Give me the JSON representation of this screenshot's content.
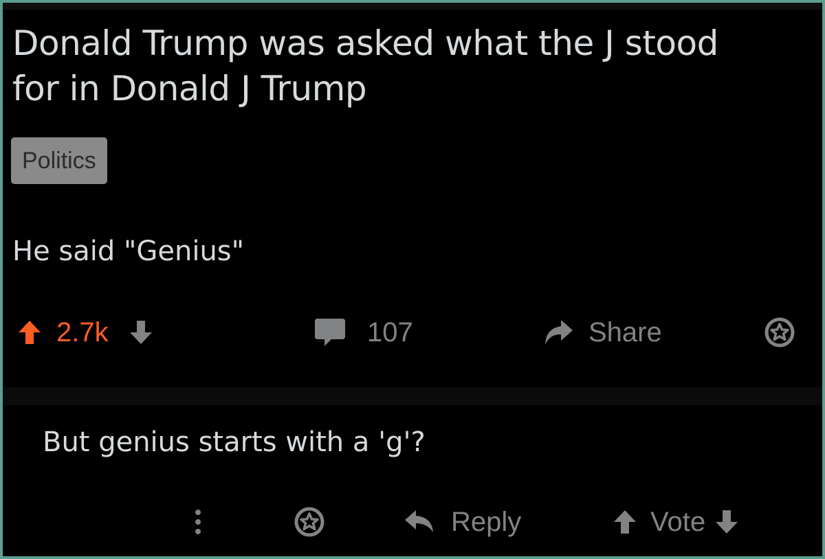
{
  "post": {
    "title": "Donald Trump was asked what the J stood for in Donald J Trump",
    "flair": "Politics",
    "body": "He said \"Genius\"",
    "score": "2.7k",
    "comment_count": "107",
    "share_label": "Share"
  },
  "comment": {
    "text": "But genius starts with a 'g'?",
    "reply_label": "Reply",
    "vote_label": "Vote"
  },
  "colors": {
    "background": "#000000",
    "upvote_active": "#ff5d22",
    "text": "#d7dadc",
    "muted": "#818384",
    "flair_bg": "#8a8a8a"
  },
  "icons": [
    "upvote-icon",
    "downvote-icon",
    "comment-icon",
    "share-icon",
    "award-icon",
    "more-icon",
    "reply-icon"
  ]
}
